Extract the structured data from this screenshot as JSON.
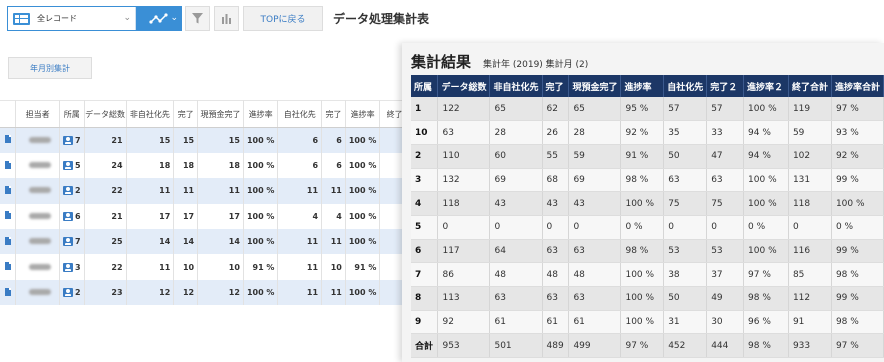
{
  "toolbar": {
    "view_select_label": "全レコード",
    "top_button_label": "TOPに戻る",
    "page_title": "データ処理集計表",
    "icons": [
      "table-view-icon",
      "graph-icon",
      "filter-icon",
      "bar-chart-icon"
    ]
  },
  "monthly_button_label": "年月別集計",
  "records_table": {
    "headers": [
      "担当者",
      "所属",
      "データ総数",
      "非自社化先",
      "完了",
      "現預金完了",
      "進捗率",
      "自社化先",
      "完了",
      "進捗率",
      "終了"
    ],
    "rows": [
      {
        "affil": "7",
        "total": "21",
        "non_own": "15",
        "done": "15",
        "cash_done": "15",
        "rate": "100 %",
        "own": "6",
        "own_done": "6",
        "own_rate": "100 %"
      },
      {
        "affil": "5",
        "total": "24",
        "non_own": "18",
        "done": "18",
        "cash_done": "18",
        "rate": "100 %",
        "own": "6",
        "own_done": "6",
        "own_rate": "100 %"
      },
      {
        "affil": "2",
        "total": "22",
        "non_own": "11",
        "done": "11",
        "cash_done": "11",
        "rate": "100 %",
        "own": "11",
        "own_done": "11",
        "own_rate": "100 %"
      },
      {
        "affil": "6",
        "total": "21",
        "non_own": "17",
        "done": "17",
        "cash_done": "17",
        "rate": "100 %",
        "own": "4",
        "own_done": "4",
        "own_rate": "100 %"
      },
      {
        "affil": "7",
        "total": "25",
        "non_own": "14",
        "done": "14",
        "cash_done": "14",
        "rate": "100 %",
        "own": "11",
        "own_done": "11",
        "own_rate": "100 %"
      },
      {
        "affil": "3",
        "total": "22",
        "non_own": "11",
        "done": "10",
        "cash_done": "10",
        "rate": "91 %",
        "own": "11",
        "own_done": "10",
        "own_rate": "91 %"
      },
      {
        "affil": "2",
        "total": "23",
        "non_own": "12",
        "done": "12",
        "cash_done": "12",
        "rate": "100 %",
        "own": "11",
        "own_done": "11",
        "own_rate": "100 %"
      }
    ]
  },
  "aggregate": {
    "title": "集計結果",
    "subtitle": "集計年 (2019) 集計月 (2)",
    "headers": [
      "所属",
      "データ総数",
      "非自社化先",
      "完了",
      "現預金完了",
      "進捗率",
      "自社化先",
      "完了２",
      "進捗率２",
      "終了合計",
      "進捗率合計"
    ],
    "rows": [
      [
        "1",
        "122",
        "65",
        "62",
        "65",
        "95 %",
        "57",
        "57",
        "100 %",
        "119",
        "97 %"
      ],
      [
        "10",
        "63",
        "28",
        "26",
        "28",
        "92 %",
        "35",
        "33",
        "94 %",
        "59",
        "93 %"
      ],
      [
        "2",
        "110",
        "60",
        "55",
        "59",
        "91 %",
        "50",
        "47",
        "94 %",
        "102",
        "92 %"
      ],
      [
        "3",
        "132",
        "69",
        "68",
        "69",
        "98 %",
        "63",
        "63",
        "100 %",
        "131",
        "99 %"
      ],
      [
        "4",
        "118",
        "43",
        "43",
        "43",
        "100 %",
        "75",
        "75",
        "100 %",
        "118",
        "100 %"
      ],
      [
        "5",
        "0",
        "0",
        "0",
        "0",
        "0 %",
        "0",
        "0",
        "0 %",
        "0",
        "0 %"
      ],
      [
        "6",
        "117",
        "64",
        "63",
        "63",
        "98 %",
        "53",
        "53",
        "100 %",
        "116",
        "99 %"
      ],
      [
        "7",
        "86",
        "48",
        "48",
        "48",
        "100 %",
        "38",
        "37",
        "97 %",
        "85",
        "98 %"
      ],
      [
        "8",
        "113",
        "63",
        "63",
        "63",
        "100 %",
        "50",
        "49",
        "98 %",
        "112",
        "99 %"
      ],
      [
        "9",
        "92",
        "61",
        "61",
        "61",
        "100 %",
        "31",
        "30",
        "96 %",
        "91",
        "98 %"
      ],
      [
        "合計",
        "953",
        "501",
        "489",
        "499",
        "97 %",
        "452",
        "444",
        "98 %",
        "933",
        "97 %"
      ]
    ]
  },
  "colors": {
    "accent": "#3a8fd6",
    "header_navy": "#1c3766",
    "row_alt_blue": "#e3ecf8"
  }
}
